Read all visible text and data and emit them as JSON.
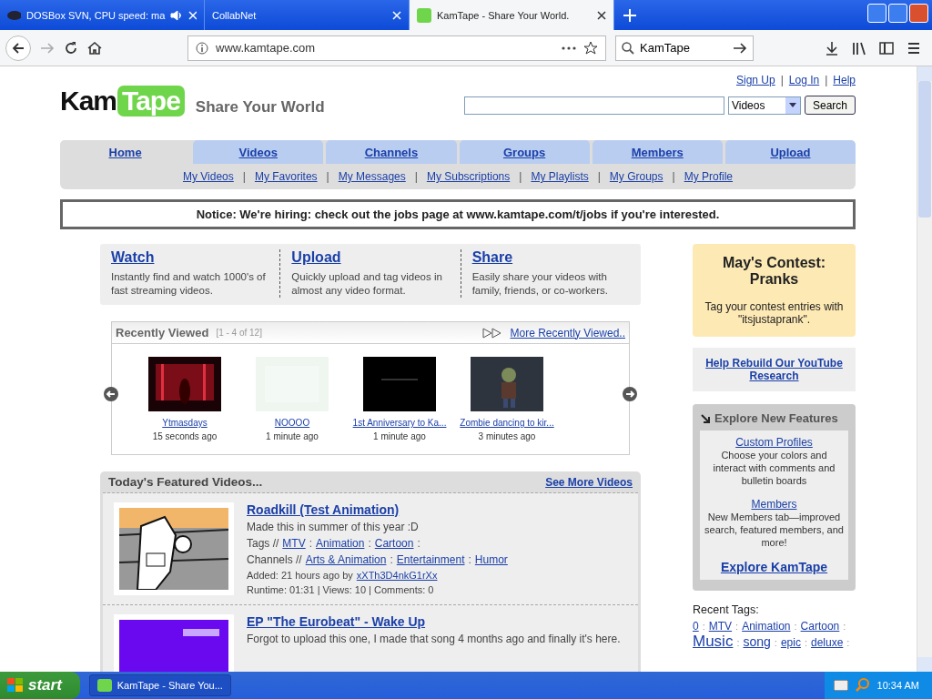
{
  "browser": {
    "tabs": [
      {
        "title": "DOSBox SVN, CPU speed: ma",
        "selected": false,
        "audio": true
      },
      {
        "title": "CollabNet",
        "selected": false,
        "audio": false
      },
      {
        "title": "KamTape - Share Your World.",
        "selected": true,
        "audio": false
      }
    ],
    "url": "www.kamtape.com",
    "search": "KamTape"
  },
  "header": {
    "logo_left": "Kam",
    "logo_right": "Tape",
    "tagline": "Share Your World",
    "account_links": [
      "Sign Up",
      "Log In",
      "Help"
    ],
    "link_separator": "|",
    "search_scope": "Videos",
    "search_button": "Search"
  },
  "nav": {
    "tabs": [
      {
        "label": "Home",
        "selected": true
      },
      {
        "label": "Videos",
        "selected": false
      },
      {
        "label": "Channels",
        "selected": false
      },
      {
        "label": "Groups",
        "selected": false
      },
      {
        "label": "Members",
        "selected": false
      },
      {
        "label": "Upload",
        "selected": false
      }
    ],
    "sub_links": [
      "My Videos",
      "My Favorites",
      "My Messages",
      "My Subscriptions",
      "My Playlists",
      "My Groups",
      "My Profile"
    ],
    "link_separator": "|"
  },
  "notice": "Notice: We're hiring: check out the jobs page at www.kamtape.com/t/jobs if you're interested.",
  "intro": [
    {
      "title": "Watch",
      "text": "Instantly find and watch 1000's of fast streaming videos."
    },
    {
      "title": "Upload",
      "text": "Quickly upload and tag videos in almost any video format."
    },
    {
      "title": "Share",
      "text": "Easily share your videos with family, friends, or co-workers."
    }
  ],
  "recently_viewed": {
    "title": "Recently Viewed",
    "range": "[1 - 4 of 12]",
    "more": "More Recently Viewed..",
    "videos": [
      {
        "title": "Ytmasdays",
        "time": "15 seconds ago",
        "kind": "red"
      },
      {
        "title": "NOOOO",
        "time": "1 minute ago",
        "kind": "blank"
      },
      {
        "title": "1st Anniversary to Ka...",
        "time": "1 minute ago",
        "kind": "dark"
      },
      {
        "title": "Zombie dancing to kir...",
        "time": "3 minutes ago",
        "kind": "figure"
      }
    ]
  },
  "featured": {
    "title": "Today's Featured Videos...",
    "more": "See More Videos",
    "separator": ":",
    "videos": [
      {
        "title": "Roadkill (Test Animation)",
        "description": "Made this in summer of this year :D",
        "kind": "cartoon",
        "tags_label": "Tags //",
        "tags": [
          "MTV",
          "Animation",
          "Cartoon"
        ],
        "channels_label": "Channels //",
        "channels": [
          "Arts & Animation",
          "Entertainment",
          "Humor"
        ],
        "added": "Added: 21 hours ago by",
        "user": "xXTh3D4nkG1rXx",
        "stats": "Runtime: 01:31 | Views: 10 | Comments: 0"
      },
      {
        "title": "EP \"The Eurobeat\" - Wake Up",
        "description": "Forgot to upload this one, I made that song 4 months ago and finally it's here.",
        "kind": "purple"
      }
    ]
  },
  "sidebar": {
    "contest": {
      "title": "May's Contest: Pranks",
      "text": "Tag your contest entries with \"itsjustaprank\"."
    },
    "help_link": "Help Rebuild Our YouTube Research",
    "explore": {
      "title": "Explore New Features",
      "items": [
        {
          "title": "Custom Profiles",
          "text": "Choose your colors and interact with comments and bulletin boards"
        },
        {
          "title": "Members",
          "text": "New Members tab—improved search, featured members, and more!"
        }
      ],
      "link": "Explore KamTape"
    },
    "recent_tags": {
      "title": "Recent Tags:",
      "separator": ":",
      "tags": [
        {
          "label": "0",
          "kind": "small"
        },
        {
          "label": "MTV",
          "kind": "small"
        },
        {
          "label": "Animation",
          "kind": "small"
        },
        {
          "label": "Cartoon",
          "kind": "small"
        },
        {
          "label": "Music",
          "kind": "large"
        },
        {
          "label": "song",
          "kind": "medium"
        },
        {
          "label": "epic",
          "kind": "small"
        },
        {
          "label": "deluxe",
          "kind": "small"
        }
      ]
    }
  },
  "taskbar": {
    "start": "start",
    "task": "KamTape - Share You...",
    "clock": "10:34 AM"
  }
}
